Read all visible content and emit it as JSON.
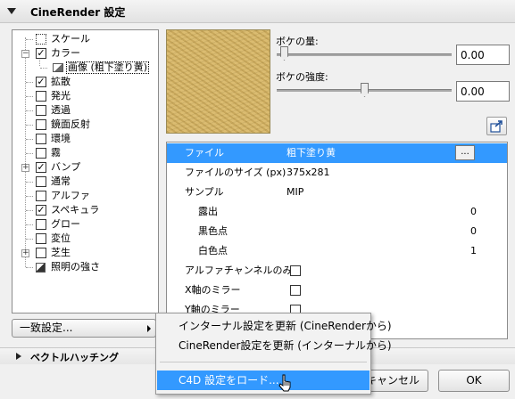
{
  "header": {
    "title": "CineRender 設定"
  },
  "tree": {
    "items": [
      {
        "label": "スケール",
        "checked": false
      },
      {
        "label": "カラー",
        "checked": true
      },
      {
        "label": "画像 (粗下塗り黄)",
        "selected": true
      },
      {
        "label": "拡散",
        "checked": true
      },
      {
        "label": "発光",
        "checked": false
      },
      {
        "label": "透過",
        "checked": false
      },
      {
        "label": "鏡面反射",
        "checked": false
      },
      {
        "label": "環境",
        "checked": false
      },
      {
        "label": "霧",
        "checked": false
      },
      {
        "label": "バンプ",
        "checked": true
      },
      {
        "label": "通常",
        "checked": false
      },
      {
        "label": "アルファ",
        "checked": false
      },
      {
        "label": "スペキュラ",
        "checked": true
      },
      {
        "label": "グロー",
        "checked": false
      },
      {
        "label": "変位",
        "checked": false
      },
      {
        "label": "芝生",
        "checked": false
      },
      {
        "label": "照明の強さ"
      }
    ]
  },
  "sliders": {
    "bokeh_amount_label": "ボケの量:",
    "bokeh_amount_value": "0.00",
    "bokeh_strength_label": "ボケの強度:",
    "bokeh_strength_value": "0.00"
  },
  "properties": {
    "rows": [
      {
        "name": "ファイル",
        "value": "粗下塗り黄",
        "button": "..."
      },
      {
        "name": "ファイルのサイズ (px)",
        "value": "375x281"
      },
      {
        "name": "サンプル",
        "value": "MIP"
      },
      {
        "name": "露出",
        "value": "0"
      },
      {
        "name": "黒色点",
        "value": "0"
      },
      {
        "name": "白色点",
        "value": "1"
      },
      {
        "name": "アルファチャンネルのみ"
      },
      {
        "name": "X軸のミラー"
      },
      {
        "name": "Y軸のミラー"
      }
    ]
  },
  "buttons": {
    "match_settings": "一致設定...",
    "cancel": "キャンセル",
    "ok": "OK"
  },
  "menu": {
    "items": [
      "インターナル設定を更新 (CineRenderから)",
      "CineRender設定を更新 (インターナルから)",
      "C4D 設定をロード..."
    ]
  },
  "bottom_section": {
    "title": "ベクトルハッチング"
  },
  "colors": {
    "selection": "#3399ff",
    "texture": "#d6b566"
  }
}
